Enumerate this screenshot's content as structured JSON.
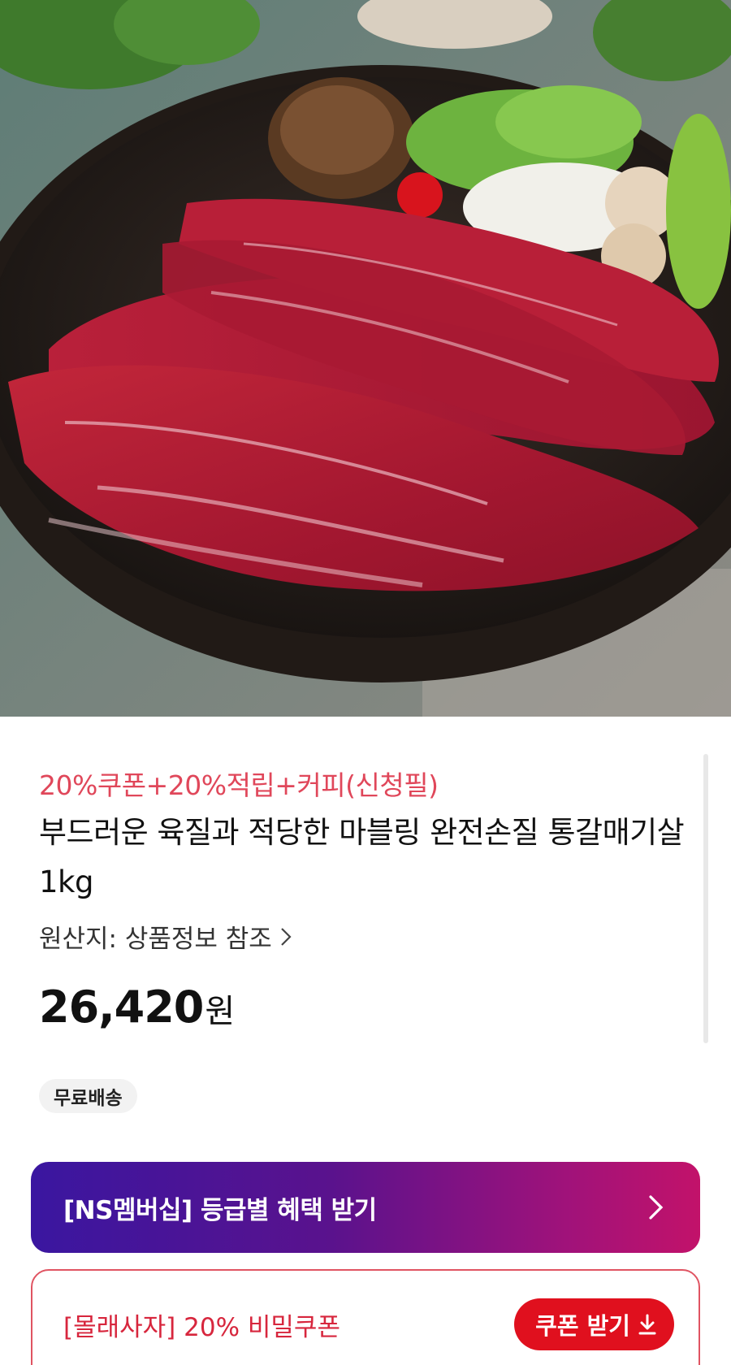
{
  "product": {
    "promo_text": "20%쿠폰+20%적립+커피(신청필)",
    "title": "부드러운 육질과 적당한 마블링 완전손질 통갈매기살 1kg",
    "origin_label": "원산지: 상품정보 참조",
    "price_number": "26,420",
    "price_unit": "원",
    "shipping_badge": "무료배송"
  },
  "membership": {
    "label": "[NS멤버십] 등급별 혜택 받기"
  },
  "coupon": {
    "label": "[몰래사자] 20% 비밀쿠폰",
    "button_label": "쿠폰 받기"
  },
  "icons": {
    "origin_chevron": "chevron-right-icon",
    "membership_chevron": "chevron-right-icon",
    "coupon_download": "download-icon"
  },
  "colors": {
    "promo": "#e0475a",
    "membership_gradient_start": "#3a16a0",
    "membership_gradient_end": "#c2126a",
    "coupon_border": "#e05462",
    "coupon_button": "#e0101e"
  }
}
